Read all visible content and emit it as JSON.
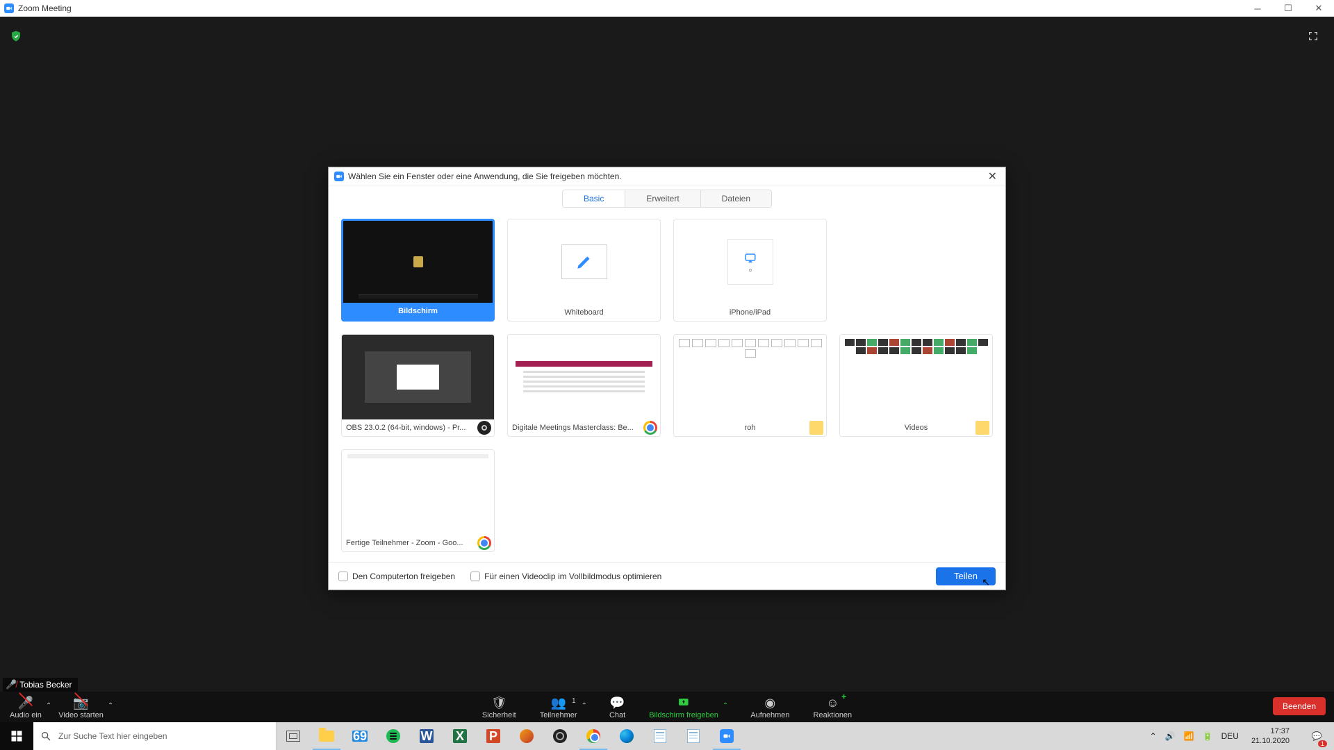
{
  "window": {
    "title": "Zoom Meeting"
  },
  "participant": {
    "name": "Tobias Becker"
  },
  "toolbar": {
    "audio": "Audio ein",
    "video": "Video starten",
    "security": "Sicherheit",
    "participants": "Teilnehmer",
    "participants_count": "1",
    "chat": "Chat",
    "share": "Bildschirm freigeben",
    "record": "Aufnehmen",
    "reactions": "Reaktionen",
    "end": "Beenden"
  },
  "share_dialog": {
    "title": "Wählen Sie ein Fenster oder eine Anwendung, die Sie freigeben möchten.",
    "tabs": {
      "basic": "Basic",
      "advanced": "Erweitert",
      "files": "Dateien"
    },
    "cards": {
      "screen": "Bildschirm",
      "whiteboard": "Whiteboard",
      "iphone": "iPhone/iPad",
      "obs": "OBS 23.0.2 (64-bit, windows) - Pr...",
      "web1": "Digitale Meetings Masterclass: Be...",
      "roh": "roh",
      "videos": "Videos",
      "web2": "Fertige Teilnehmer - Zoom - Goo..."
    },
    "footer": {
      "share_audio": "Den Computerton freigeben",
      "optimize_video": "Für einen Videoclip im Vollbildmodus optimieren",
      "share_button": "Teilen"
    }
  },
  "taskbar": {
    "search_placeholder": "Zur Suche Text hier eingeben",
    "mail_badge": "69",
    "lang": "DEU",
    "time": "17:37",
    "date": "21.10.2020",
    "notif_count": "1"
  }
}
